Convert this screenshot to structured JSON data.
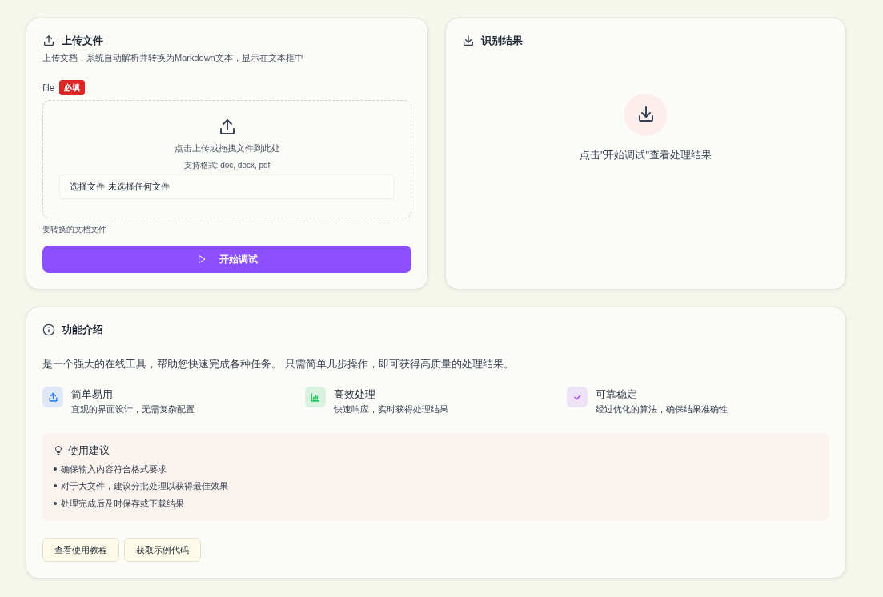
{
  "upload_card": {
    "title": "上传文件",
    "description": "上传文档，系统自动解析并转换为Markdown文本，显示在文本框中",
    "field_label": "file",
    "required_badge": "必填",
    "dropzone_text": "点击上传或拖拽文件到此处",
    "formats": "支持格式: doc, docx, pdf",
    "file_input": {
      "button": "选择文件",
      "value": "未选择任何文件"
    },
    "help": "要转换的文档文件",
    "submit": "开始调试"
  },
  "result_card": {
    "title": "识别结果",
    "empty_text": "点击\"开始调试\"查看处理结果"
  },
  "intro_card": {
    "title": "功能介绍",
    "description": "是一个强大的在线工具，帮助您快速完成各种任务。 只需简单几步操作，即可获得高质量的处理结果。",
    "features": [
      {
        "kind": "upload",
        "color": "#3b82f6",
        "title": "简单易用",
        "text": "直观的界面设计，无需复杂配置"
      },
      {
        "kind": "chart",
        "color": "#22c55e",
        "title": "高效处理",
        "text": "快速响应，实时获得处理结果"
      },
      {
        "kind": "check",
        "color": "#a855f7",
        "title": "可靠稳定",
        "text": "经过优化的算法，确保结果准确性"
      }
    ],
    "tips": {
      "title": "使用建议",
      "items": [
        "确保输入内容符合格式要求",
        "对于大文件，建议分批处理以获得最佳效果",
        "处理完成后及时保存或下载结果"
      ]
    },
    "buttons": [
      "查看使用教程",
      "获取示例代码"
    ]
  }
}
